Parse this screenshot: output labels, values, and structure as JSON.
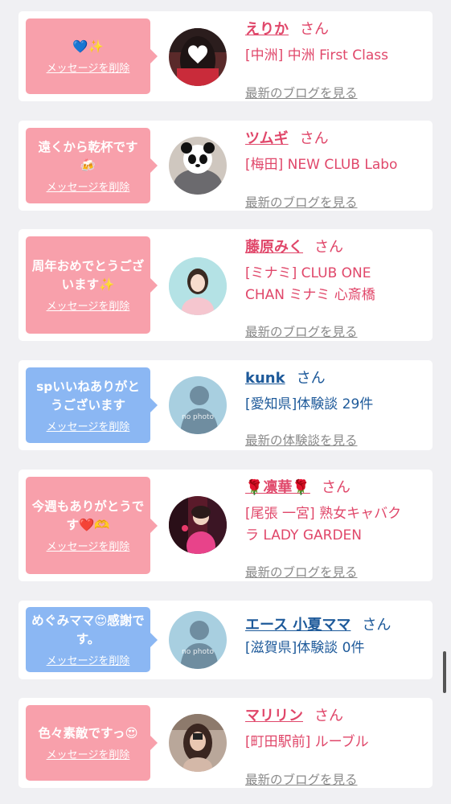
{
  "cards": [
    {
      "theme": "pink",
      "message": "💙✨",
      "delete_label": "メッセージを削除",
      "name": "えりか",
      "honorific": "さん",
      "shop_lines": [
        "[中洲] 中洲 First Class"
      ],
      "link": "最新のブログを見る",
      "avatar_icon": "heart-face-photo"
    },
    {
      "theme": "pink",
      "message": "遠くから乾杯です🍻",
      "delete_label": "メッセージを削除",
      "name": "ツムギ",
      "honorific": "さん",
      "shop_lines": [
        "[梅田] NEW CLUB Labo"
      ],
      "link": "最新のブログを見る",
      "avatar_icon": "panda-face-photo"
    },
    {
      "theme": "pink",
      "message": "周年おめでとうございます✨",
      "delete_label": "メッセージを削除",
      "name": "藤原みく",
      "honorific": "さん",
      "shop_lines": [
        "[ミナミ] CLUB ONE",
        "CHAN ミナミ 心斎橋"
      ],
      "link": "最新のブログを見る",
      "avatar_icon": "portrait-photo"
    },
    {
      "theme": "blue",
      "message": "spいいねありがとうございます",
      "delete_label": "メッセージを削除",
      "name": "kunk",
      "honorific": "さん",
      "shop_lines": [
        "[愛知県]体験談 29件"
      ],
      "link": "最新の体験談を見る",
      "avatar_icon": "no-photo-silhouette",
      "avatar_text": "no photo"
    },
    {
      "theme": "pink",
      "message": "今週もありがとうです❤️🫶",
      "delete_label": "メッセージを削除",
      "name": "🌹凛華🌹",
      "honorific": "さん",
      "shop_lines": [
        "[尾張 一宮] 熟女キャバク",
        "ラ LADY GARDEN"
      ],
      "link": "最新のブログを見る",
      "avatar_icon": "kimono-photo"
    },
    {
      "theme": "blue",
      "message": "めぐみママ😍感謝です。",
      "delete_label": "メッセージを削除",
      "name": "エース 小夏ママ",
      "honorific": "さん",
      "shop_lines": [
        "[滋賀県]体験談 0件"
      ],
      "link": "最新の体験談を見る",
      "avatar_icon": "no-photo-silhouette",
      "avatar_text": "no photo"
    },
    {
      "theme": "pink",
      "message": "色々素敵ですっ😍",
      "delete_label": "メッセージを削除",
      "name": "マリリン",
      "honorific": "さん",
      "shop_lines": [
        "[町田駅前] ルーブル"
      ],
      "link": "最新のブログを見る",
      "avatar_icon": "mirror-selfie-photo"
    }
  ]
}
